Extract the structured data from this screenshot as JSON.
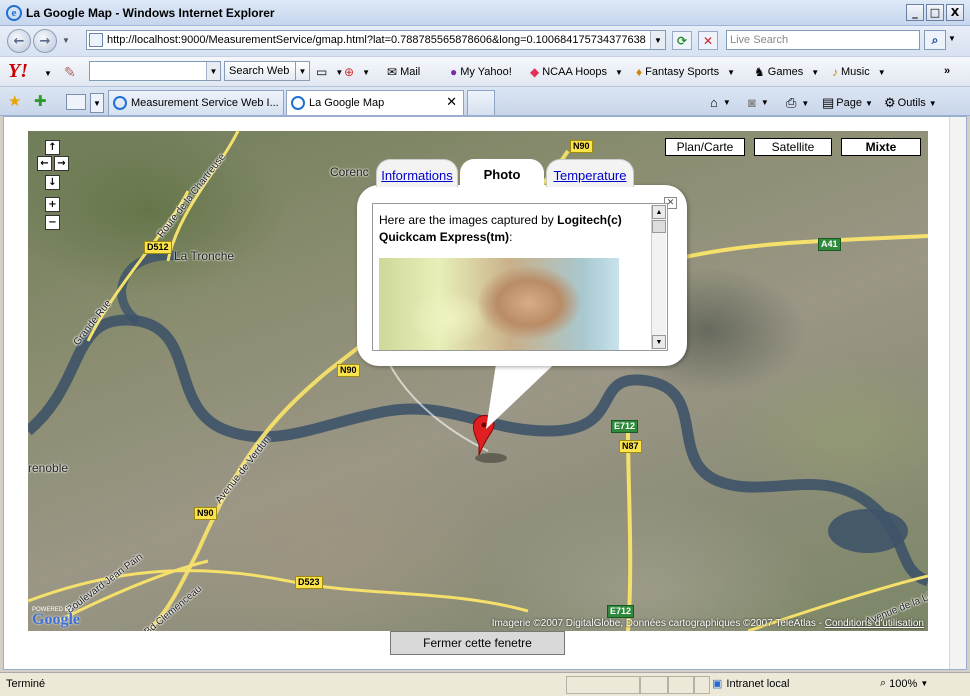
{
  "window": {
    "title": "La Google Map - Windows Internet Explorer",
    "min": "_",
    "max": "□",
    "close": "X"
  },
  "address": {
    "url": "http://localhost:9000/MeasurementService/gmap.html?lat=0.788785565878606&long=0.100684175734377638"
  },
  "search": {
    "placeholder": "Live Search"
  },
  "yahoo": {
    "logo": "Y!",
    "search_btn": "Search Web",
    "items": [
      {
        "label": "Mail",
        "icon": "✉"
      },
      {
        "label": "My Yahoo!",
        "icon": "●"
      },
      {
        "label": "NCAA Hoops",
        "icon": "◆"
      },
      {
        "label": "Fantasy Sports",
        "icon": "♦"
      },
      {
        "label": "Games",
        "icon": "♞"
      },
      {
        "label": "Music",
        "icon": "♪"
      }
    ],
    "more": "»"
  },
  "tabs": [
    {
      "label": "Measurement Service Web I..."
    },
    {
      "label": "La Google Map"
    }
  ],
  "commands": {
    "page": "Page",
    "tools": "Outils"
  },
  "map": {
    "types": [
      "Plan/Carte",
      "Satellite",
      "Mixte"
    ],
    "roads": [
      "N90",
      "D512",
      "A41",
      "N90",
      "E712",
      "N87",
      "N90",
      "D523",
      "E712"
    ],
    "places": [
      "Corenc",
      "La Tronche",
      "renoble"
    ],
    "streets": [
      "Route de la Chartreuse",
      "Grande Rue",
      "Avenue de Verdun",
      "Boulevard Jean Pain",
      "Avenue de la Libération",
      "Bd Clemenceau"
    ],
    "copyright": "Imagerie ©2007 DigitalGlobe, Données cartographiques ©2007 TeleAtlas -",
    "terms": "Conditions d'utilisation",
    "powered": "POWERED BY",
    "glogo": "Google"
  },
  "info": {
    "tabs": [
      "Informations",
      "Photo",
      "Temperature"
    ],
    "text_prefix": "Here are the images captured by ",
    "device": "Logitech(c) Quickcam Express(tm)",
    "text_suffix": ":"
  },
  "close_button": "Fermer cette fenetre",
  "status": {
    "text": "Terminé",
    "zone": "Intranet local",
    "zoom": "100%"
  }
}
